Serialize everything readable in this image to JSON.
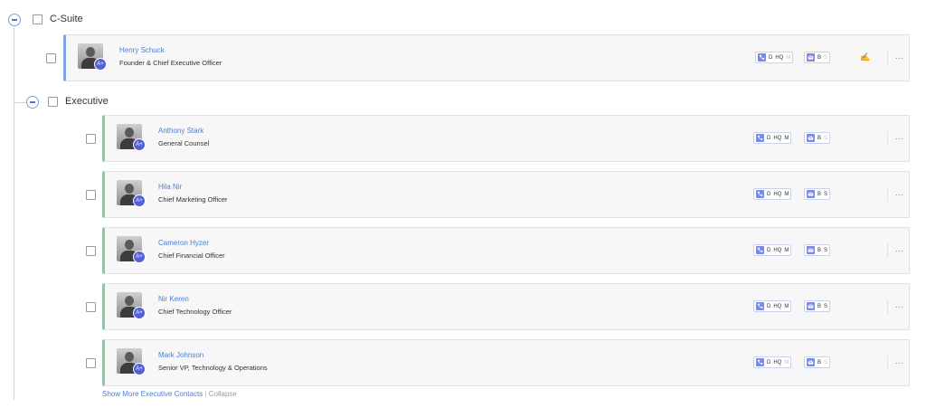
{
  "groups": {
    "csuite": {
      "label": "C-Suite"
    },
    "executive": {
      "label": "Executive"
    }
  },
  "contacts": [
    {
      "name": "Henry Schuck",
      "title": "Founder & Chief Executive Officer",
      "score": "A+",
      "phone_labels": [
        "D",
        "HQ",
        "M"
      ],
      "email_labels": [
        "B",
        "S"
      ],
      "m_active": false,
      "s_active": false
    },
    {
      "name": "Anthony Stark",
      "title": "General Counsel",
      "score": "A+",
      "phone_labels": [
        "D",
        "HQ",
        "M"
      ],
      "email_labels": [
        "B",
        "S"
      ],
      "m_active": true,
      "s_active": false
    },
    {
      "name": "Hila Nir",
      "title": "Chief Marketing Officer",
      "score": "A+",
      "phone_labels": [
        "D",
        "HQ",
        "M"
      ],
      "email_labels": [
        "B",
        "S"
      ],
      "m_active": true,
      "s_active": true
    },
    {
      "name": "Cameron Hyzer",
      "title": "Chief Financial Officer",
      "score": "A+",
      "phone_labels": [
        "D",
        "HQ",
        "M"
      ],
      "email_labels": [
        "B",
        "S"
      ],
      "m_active": true,
      "s_active": true
    },
    {
      "name": "Nir Keren",
      "title": "Chief Technology Officer",
      "score": "A+",
      "phone_labels": [
        "D",
        "HQ",
        "M"
      ],
      "email_labels": [
        "B",
        "S"
      ],
      "m_active": true,
      "s_active": true
    },
    {
      "name": "Mark Johnson",
      "title": "Senior VP, Technology & Operations",
      "score": "A+",
      "phone_labels": [
        "D",
        "HQ",
        "M"
      ],
      "email_labels": [
        "B",
        "S"
      ],
      "m_active": false,
      "s_active": false
    }
  ],
  "more_label": "...",
  "footer": {
    "show_more": "Show More Executive Contacts",
    "separator": "|",
    "collapse": "Collapse"
  },
  "colors": {
    "accent": "#4a7fd6",
    "csuite_bar": "#7ea3e8",
    "executive_bar": "#7fd0a0",
    "score_badge": "#5560d8"
  }
}
